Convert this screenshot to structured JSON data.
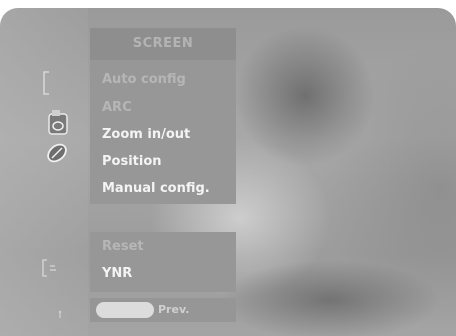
{
  "menu": {
    "title": "SCREEN",
    "items": [
      {
        "label": "Auto config",
        "state": "dim"
      },
      {
        "label": "ARC",
        "state": "dim"
      },
      {
        "label": "Zoom in/out",
        "state": "bright"
      },
      {
        "label": "Position",
        "state": "bright"
      },
      {
        "label": "Manual config.",
        "state": "bright"
      }
    ],
    "items2": [
      {
        "label": "Reset",
        "state": "dim"
      },
      {
        "label": "YNR",
        "state": "bright"
      }
    ]
  },
  "footer": {
    "prev_label": "Prev."
  },
  "sidebar_icons": [
    "bracket-icon",
    "screen-icon",
    "leaf-icon",
    "input-icon",
    "dot-icon"
  ]
}
